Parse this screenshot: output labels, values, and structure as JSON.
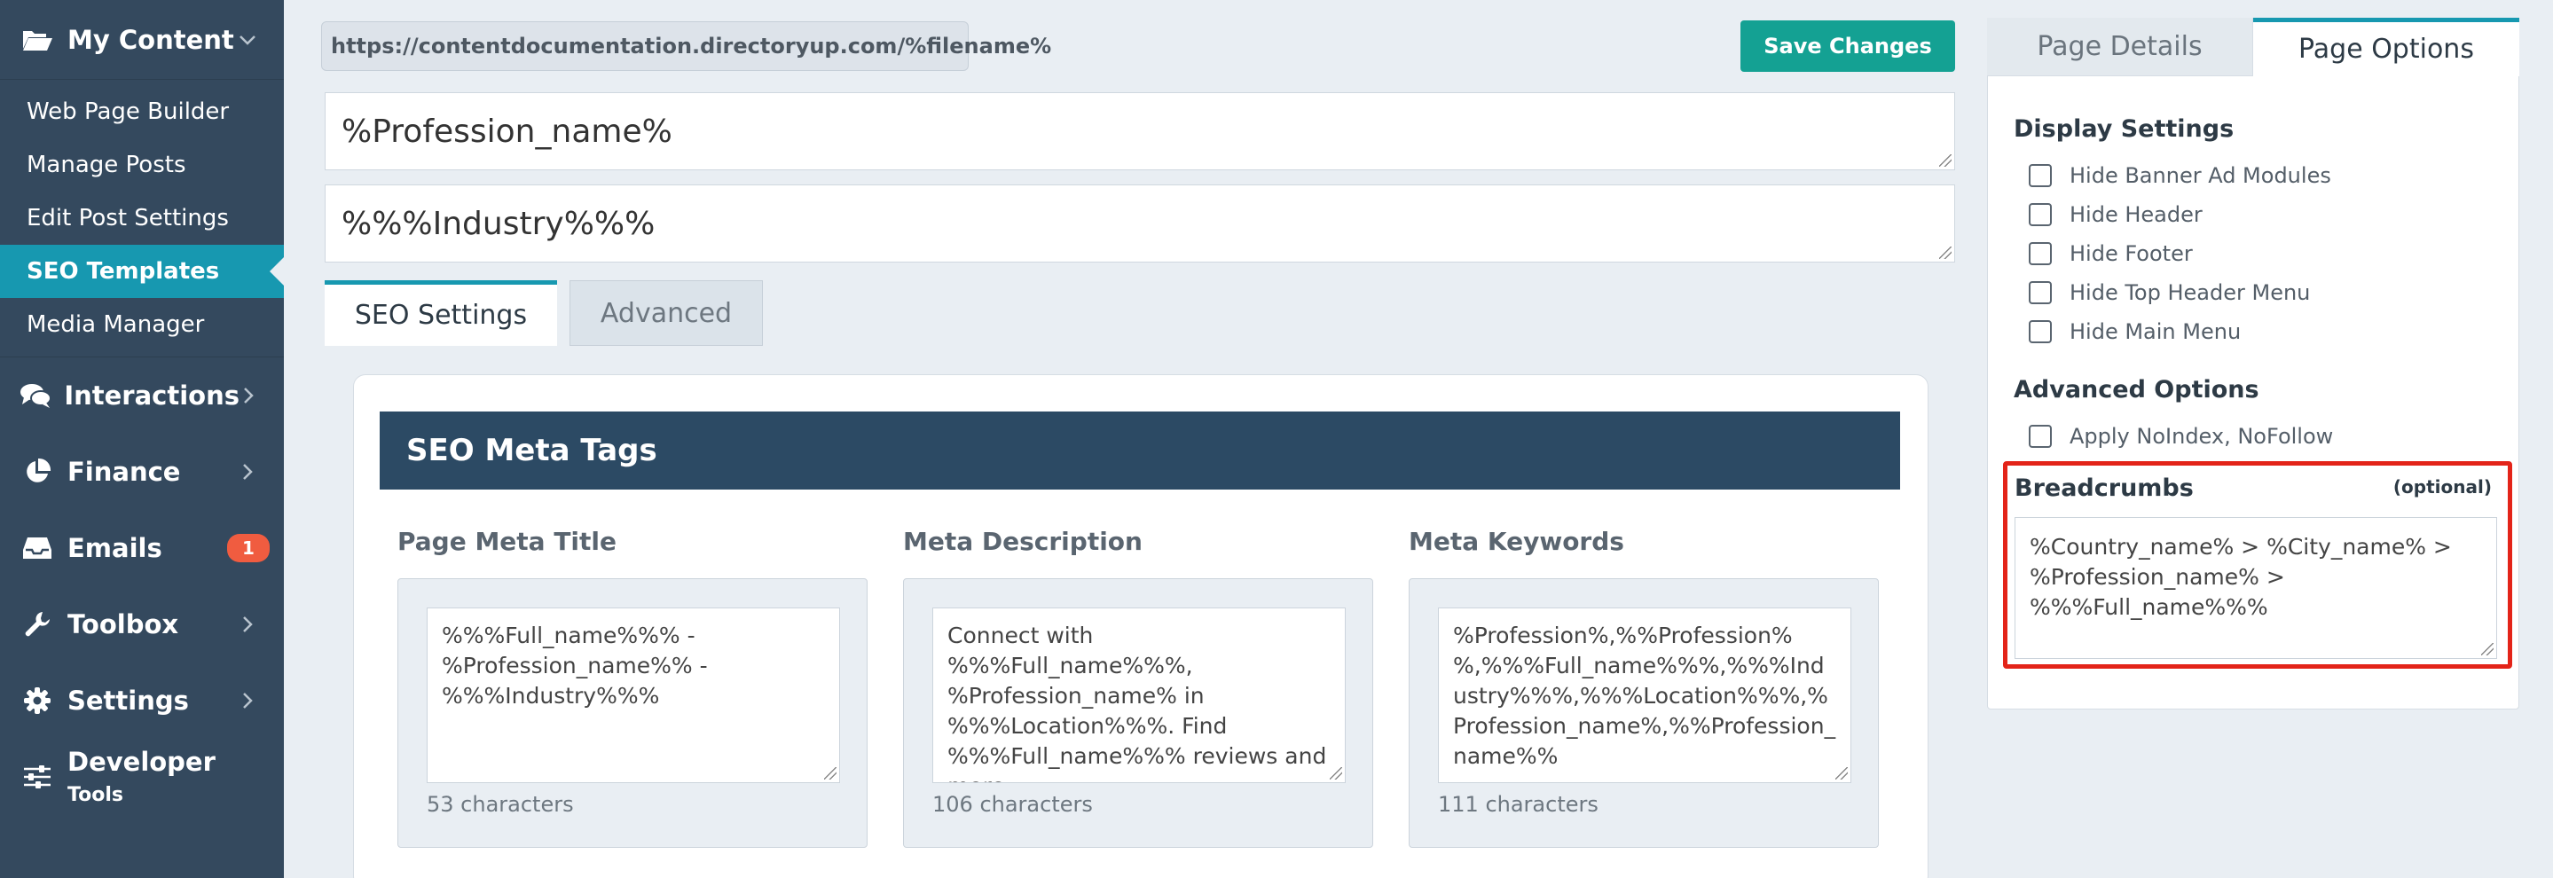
{
  "sidebar": {
    "my_content": {
      "label": "My Content"
    },
    "sub_items": [
      {
        "label": "Web Page Builder"
      },
      {
        "label": "Manage Posts"
      },
      {
        "label": "Edit Post Settings"
      },
      {
        "label": "SEO Templates"
      },
      {
        "label": "Media Manager"
      }
    ],
    "sections": [
      {
        "label": "Interactions"
      },
      {
        "label": "Finance"
      },
      {
        "label": "Emails",
        "badge": "1"
      },
      {
        "label": "Toolbox"
      },
      {
        "label": "Settings"
      }
    ],
    "developer": {
      "label": "Developer",
      "small": "Tools"
    }
  },
  "url": {
    "value": "https://contentdocumentation.directoryup.com/%filename%"
  },
  "toolbar": {
    "save_label": "Save Changes"
  },
  "fields": {
    "name": "%Profession_name%",
    "industry": "%%%Industry%%%"
  },
  "tabs": {
    "seo": "SEO Settings",
    "advanced": "Advanced"
  },
  "meta": {
    "heading": "SEO Meta Tags",
    "title": {
      "label": "Page Meta Title",
      "value": "%%%Full_name%%% - %Profession_name%% - %%%Industry%%%",
      "count": "53 characters"
    },
    "description": {
      "label": "Meta Description",
      "value": "Connect with %%%Full_name%%%, %Profession_name% in %%%Location%%%. Find %%%Full_name%%% reviews and more.",
      "count": "106 characters"
    },
    "keywords": {
      "label": "Meta Keywords",
      "value": "%Profession%,%%Profession%%,%%%Full_name%%%,%%%Industry%%%,%%%Location%%%,%Profession_name%,%%Profession_name%%",
      "count": "111 characters"
    }
  },
  "right_panel": {
    "tab_details": "Page Details",
    "tab_options": "Page Options",
    "display_heading": "Display Settings",
    "display_items": [
      {
        "label": "Hide Banner Ad Modules"
      },
      {
        "label": "Hide Header"
      },
      {
        "label": "Hide Footer"
      },
      {
        "label": "Hide Top Header Menu"
      },
      {
        "label": "Hide Main Menu"
      }
    ],
    "advanced_heading": "Advanced Options",
    "advanced_items": [
      {
        "label": "Apply NoIndex, NoFollow"
      }
    ],
    "breadcrumbs": {
      "label": "Breadcrumbs",
      "optional": "(optional)",
      "value": "%Country_name% > %City_name% > %Profession_name% > %%%Full_name%%%"
    }
  },
  "colors": {
    "sidebar_bg": "#34495e",
    "accent": "#1798b0",
    "save": "#14a193",
    "badge": "#f05c40",
    "highlight": "#e32419",
    "meta_head": "#2c4a64"
  }
}
